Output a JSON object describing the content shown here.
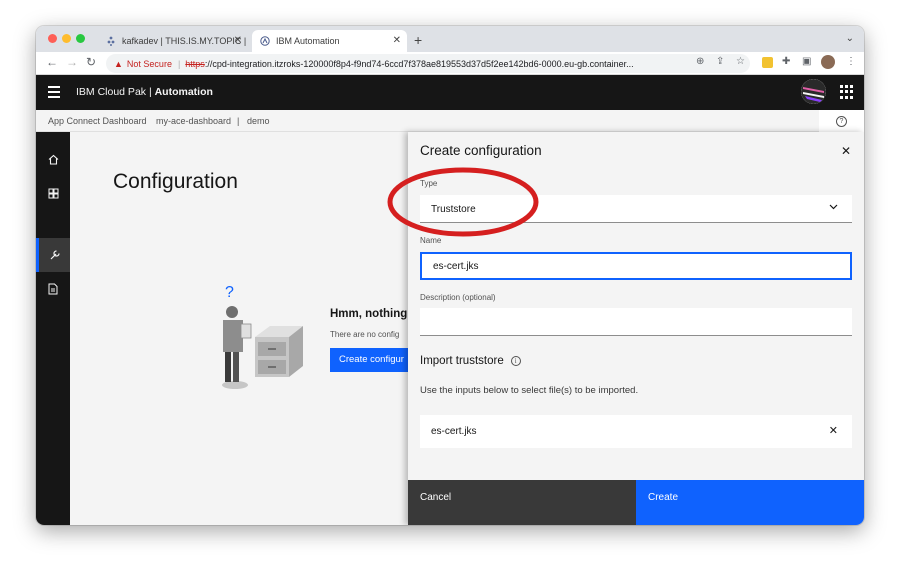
{
  "browser": {
    "tabs": [
      {
        "title": "kafkadev | THIS.IS.MY.TOPIC |",
        "active": false
      },
      {
        "title": "IBM Automation",
        "active": true
      }
    ],
    "url": {
      "warning": "Not Secure",
      "scheme": "https",
      "rest": "://cpd-integration.itzroks-120000f8p4-f9nd74-6ccd7f378ae819553d37d5f2ee142bd6-0000.eu-gb.container..."
    }
  },
  "header": {
    "brand_prefix": "IBM Cloud Pak | ",
    "brand_product": "Automation"
  },
  "breadcrumb": [
    "App Connect Dashboard",
    "my-ace-dashboard",
    "|",
    "demo"
  ],
  "main": {
    "title": "Configuration",
    "empty_heading": "Hmm, nothing",
    "empty_sub": "There are no config",
    "empty_button": "Create configur"
  },
  "panel": {
    "title": "Create configuration",
    "type_label": "Type",
    "type_value": "Truststore",
    "name_label": "Name",
    "name_value": "es-cert.jks",
    "description_label": "Description (optional)",
    "description_value": "",
    "import_heading": "Import truststore",
    "import_desc": "Use the inputs below to select file(s) to be imported.",
    "file_name": "es-cert.jks",
    "cancel_label": "Cancel",
    "create_label": "Create"
  },
  "colors": {
    "ibm_blue": "#0f62fe",
    "header_bg": "#161616",
    "annotation_red": "#d51f1f"
  }
}
